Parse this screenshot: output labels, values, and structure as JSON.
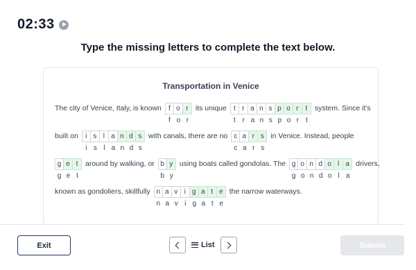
{
  "timer": {
    "time": "02:33",
    "icon": "play-circle-icon"
  },
  "instruction": "Type the missing letters to complete the text below.",
  "passage": {
    "title": "Transportation in Venice",
    "lines": [
      [
        {
          "t": "text",
          "v": "The city of Venice, Italy, is known"
        },
        {
          "t": "word",
          "given": [
            "f",
            "o"
          ],
          "filled": [
            "r"
          ],
          "hint": "for"
        },
        {
          "t": "text",
          "v": "its unique"
        },
        {
          "t": "word",
          "given": [
            "t",
            "r",
            "a",
            "n",
            "s"
          ],
          "filled": [
            "p",
            "o",
            "r",
            "t"
          ],
          "hint": "transport"
        },
        {
          "t": "text",
          "v": "system. Since it's"
        }
      ],
      [
        {
          "t": "text",
          "v": "built on"
        },
        {
          "t": "word",
          "given": [
            "i",
            "s",
            "l",
            "a"
          ],
          "filled": [
            "n",
            "d",
            "s"
          ],
          "hint": "islands"
        },
        {
          "t": "text",
          "v": "with canals, there are no"
        },
        {
          "t": "word",
          "given": [
            "c",
            "a"
          ],
          "filled": [
            "r",
            "s"
          ],
          "hint": "cars"
        },
        {
          "t": "text",
          "v": "in Venice. Instead, people"
        }
      ],
      [
        {
          "t": "word",
          "given": [
            "g"
          ],
          "filled": [
            "e",
            "t"
          ],
          "hint": "get",
          "first": true
        },
        {
          "t": "text",
          "v": "around by walking, or"
        },
        {
          "t": "word",
          "given": [
            "b"
          ],
          "filled": [
            "y"
          ],
          "hint": "by"
        },
        {
          "t": "text",
          "v": "using boats called gondolas. The"
        },
        {
          "t": "word",
          "given": [
            "g",
            "o",
            "n",
            "d"
          ],
          "filled": [
            "o",
            "l",
            "a"
          ],
          "hint": "gondola"
        },
        {
          "t": "text",
          "v": "drivers,"
        }
      ],
      [
        {
          "t": "text",
          "v": "known as gondoliers, skillfully"
        },
        {
          "t": "word",
          "given": [
            "n",
            "a",
            "v",
            "i"
          ],
          "filled": [
            "g",
            "a",
            "t",
            "e"
          ],
          "hint": "navigate"
        },
        {
          "t": "text",
          "v": "the narrow waterways."
        }
      ]
    ]
  },
  "footer": {
    "exit_label": "Exit",
    "list_label": "List",
    "submit_label": "Submit"
  },
  "colors": {
    "filled_cell": "#e6f6ea",
    "submit_disabled": "#e5e7eb"
  }
}
